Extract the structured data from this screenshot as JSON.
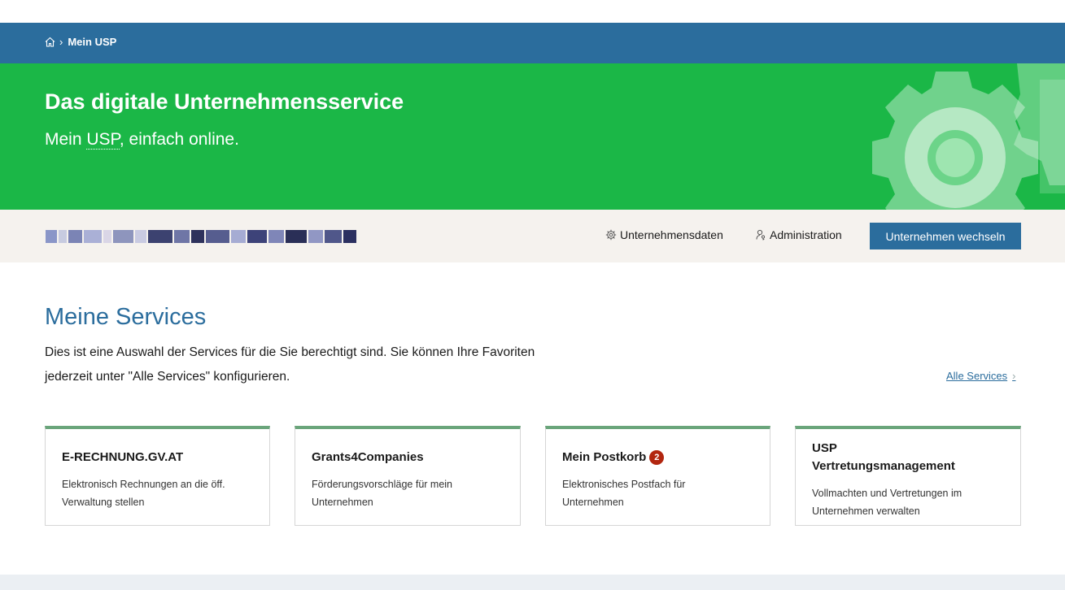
{
  "breadcrumb": {
    "home_icon": "home-icon",
    "current": "Mein USP"
  },
  "hero": {
    "title": "Das digitale Unternehmensservice",
    "subtitle_before": "Mein ",
    "subtitle_abbr": "USP",
    "subtitle_after": ", einfach online."
  },
  "company_bar": {
    "company_name_redacted": true,
    "links": [
      {
        "label": "Unternehmensdaten",
        "icon": "gear-icon"
      },
      {
        "label": "Administration",
        "icon": "person-key-icon"
      }
    ],
    "switch_button": "Unternehmen wechseln"
  },
  "services": {
    "title": "Meine Services",
    "description": "Dies ist eine Auswahl der Services für die Sie berechtigt sind. Sie können Ihre Favoriten jederzeit unter \"Alle Services\" konfigurieren.",
    "all_link": "Alle Services",
    "cards": [
      {
        "title": "E-RECHNUNG.GV.AT",
        "text": "Elektronisch Rechnungen an die öff. Verwaltung stellen"
      },
      {
        "title": "Grants4Companies",
        "text": "Förderungsvorschläge für mein Unternehmen"
      },
      {
        "title": "Mein Postkorb",
        "badge": "2",
        "text": "Elektronisches Postfach für Unternehmen"
      },
      {
        "title": "USP Vertretungsmanagement",
        "text": "Vollmachten und Vertretungen im Unternehmen verwalten"
      }
    ]
  },
  "colors": {
    "primary_blue": "#2b6d9d",
    "hero_green": "#1bb747",
    "card_accent": "#6aa57b",
    "badge_red": "#b2260f"
  }
}
